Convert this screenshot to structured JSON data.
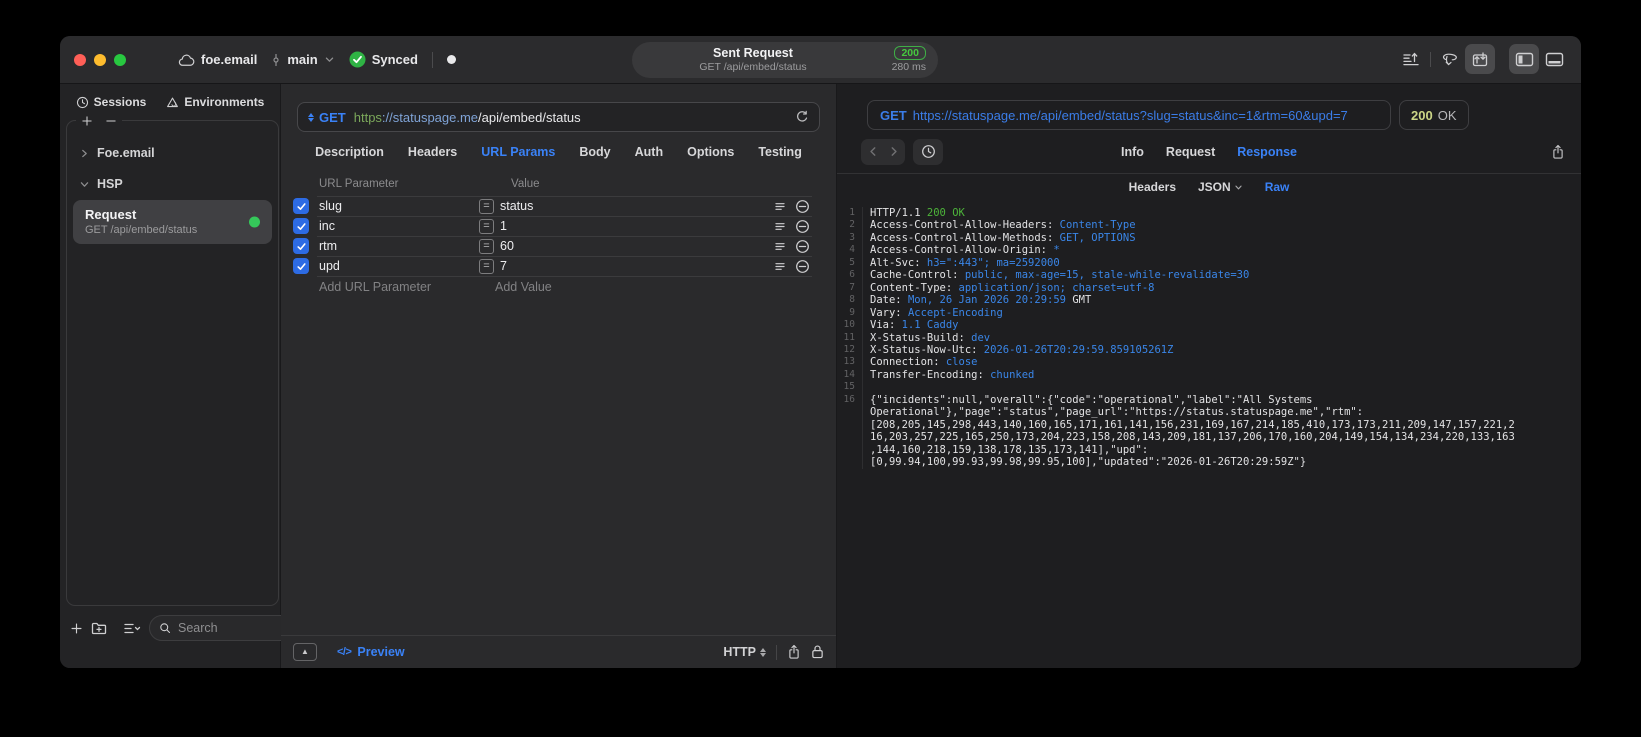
{
  "glyphs": {
    "equals": "=",
    "code": "</>",
    "collapse": "▲"
  },
  "colors": {
    "accent_blue": "#3a82f7",
    "checkbox_blue": "#2d6be4",
    "status_green_badge": "#46c93f",
    "status_code_yellowgreen": "#ccd687",
    "response_value_blue": "#3a86e8",
    "response_status_green": "#4db43a",
    "traffic_red": "#ff5f57",
    "traffic_yellow": "#febc2e",
    "traffic_green": "#28c840"
  },
  "titlebar": {
    "project": "foe.email",
    "branch": "main",
    "sync": "Synced",
    "summary": {
      "title": "Sent Request",
      "subtitle": "GET /api/embed/status",
      "status": "200",
      "time": "280 ms"
    }
  },
  "sidebar": {
    "tabs": [
      {
        "label": "Sessions"
      },
      {
        "label": "Environments"
      }
    ],
    "groups": [
      {
        "label": "Foe.email",
        "expanded": false
      },
      {
        "label": "HSP",
        "expanded": true
      }
    ],
    "request": {
      "title": "Request",
      "subtitle": "GET /api/embed/status"
    },
    "search_placeholder": "Search"
  },
  "request_pane": {
    "method": "GET",
    "url": {
      "scheme": "https",
      "host": "://statuspage.me",
      "path": "/api/embed/status"
    },
    "tabs": [
      "Description",
      "Headers",
      "URL Params",
      "Body",
      "Auth",
      "Options",
      "Testing"
    ],
    "active_tab": "URL Params",
    "table": {
      "col_name": "URL Parameter",
      "col_value": "Value",
      "rows": [
        {
          "name": "slug",
          "value": "status",
          "enabled": true
        },
        {
          "name": "inc",
          "value": "1",
          "enabled": true
        },
        {
          "name": "rtm",
          "value": "60",
          "enabled": true
        },
        {
          "name": "upd",
          "value": "7",
          "enabled": true
        }
      ],
      "add_name": "Add URL Parameter",
      "add_value": "Add Value"
    },
    "footer": {
      "preview": "Preview",
      "protocol": "HTTP"
    }
  },
  "response_pane": {
    "method": "GET",
    "url": "https://statuspage.me/api/embed/status?slug=status&inc=1&rtm=60&upd=7",
    "status_code": "200",
    "status_text": "OK",
    "tabs": [
      "Info",
      "Request",
      "Response"
    ],
    "active_tab": "Response",
    "subtabs": [
      "Headers",
      "JSON",
      "Raw"
    ],
    "active_subtab": "Raw",
    "lines": [
      {
        "num": "1",
        "segments": [
          {
            "text": "HTTP/1.1 ",
            "color": "fg"
          },
          {
            "text": "200 OK",
            "color": "green"
          }
        ]
      },
      {
        "num": "2",
        "segments": [
          {
            "text": "Access-Control-Allow-Headers: ",
            "color": "fg"
          },
          {
            "text": "Content-Type",
            "color": "blue"
          }
        ]
      },
      {
        "num": "3",
        "segments": [
          {
            "text": "Access-Control-Allow-Methods: ",
            "color": "fg"
          },
          {
            "text": "GET, OPTIONS",
            "color": "blue"
          }
        ]
      },
      {
        "num": "4",
        "segments": [
          {
            "text": "Access-Control-Allow-Origin: ",
            "color": "fg"
          },
          {
            "text": "*",
            "color": "blue"
          }
        ]
      },
      {
        "num": "5",
        "segments": [
          {
            "text": "Alt-Svc: ",
            "color": "fg"
          },
          {
            "text": "h3=\":443\"; ma=2592000",
            "color": "blue"
          }
        ]
      },
      {
        "num": "6",
        "segments": [
          {
            "text": "Cache-Control: ",
            "color": "fg"
          },
          {
            "text": "public, max-age=15, stale-while-revalidate=30",
            "color": "blue"
          }
        ]
      },
      {
        "num": "7",
        "segments": [
          {
            "text": "Content-Type: ",
            "color": "fg"
          },
          {
            "text": "application/json; charset=utf-8",
            "color": "blue"
          }
        ]
      },
      {
        "num": "8",
        "segments": [
          {
            "text": "Date: ",
            "color": "fg"
          },
          {
            "text": "Mon, 26 Jan 2026 20:29:59 ",
            "color": "blue"
          },
          {
            "text": "GMT",
            "color": "fg"
          }
        ]
      },
      {
        "num": "9",
        "segments": [
          {
            "text": "Vary: ",
            "color": "fg"
          },
          {
            "text": "Accept-Encoding",
            "color": "blue"
          }
        ]
      },
      {
        "num": "10",
        "segments": [
          {
            "text": "Via: ",
            "color": "fg"
          },
          {
            "text": "1.1 Caddy",
            "color": "blue"
          }
        ]
      },
      {
        "num": "11",
        "segments": [
          {
            "text": "X-Status-Build: ",
            "color": "fg"
          },
          {
            "text": "dev",
            "color": "blue"
          }
        ]
      },
      {
        "num": "12",
        "segments": [
          {
            "text": "X-Status-Now-Utc: ",
            "color": "fg"
          },
          {
            "text": "2026-01-26T20:29:59.859105261Z",
            "color": "blue"
          }
        ]
      },
      {
        "num": "13",
        "segments": [
          {
            "text": "Connection: ",
            "color": "fg"
          },
          {
            "text": "close",
            "color": "blue"
          }
        ]
      },
      {
        "num": "14",
        "segments": [
          {
            "text": "Transfer-Encoding: ",
            "color": "fg"
          },
          {
            "text": "chunked",
            "color": "blue"
          }
        ]
      },
      {
        "num": "15",
        "segments": []
      },
      {
        "num": "16",
        "wrap": true,
        "segments": [
          {
            "text": "{\"incidents\":null,\"overall\":{\"code\":\"operational\",\"label\":\"All Systems Operational\"},\"page\":\"status\",\"page_url\":\"https://status.statuspage.me\",\"rtm\":\n[208,205,145,298,443,140,160,165,171,161,141,156,231,169,167,214,185,410,173,173,211,209,147,157,221,216,203,257,225,165,250,173,204,223,158,208,143,209,181,137,206,170,160,204,149,154,134,234,220,133,163,144,160,218,159,138,178,135,173,141],\"upd\":\n[0,99.94,100,99.93,99.98,99.95,100],\"updated\":\"2026-01-26T20:29:59Z\"}",
            "color": "fg"
          }
        ]
      }
    ]
  }
}
